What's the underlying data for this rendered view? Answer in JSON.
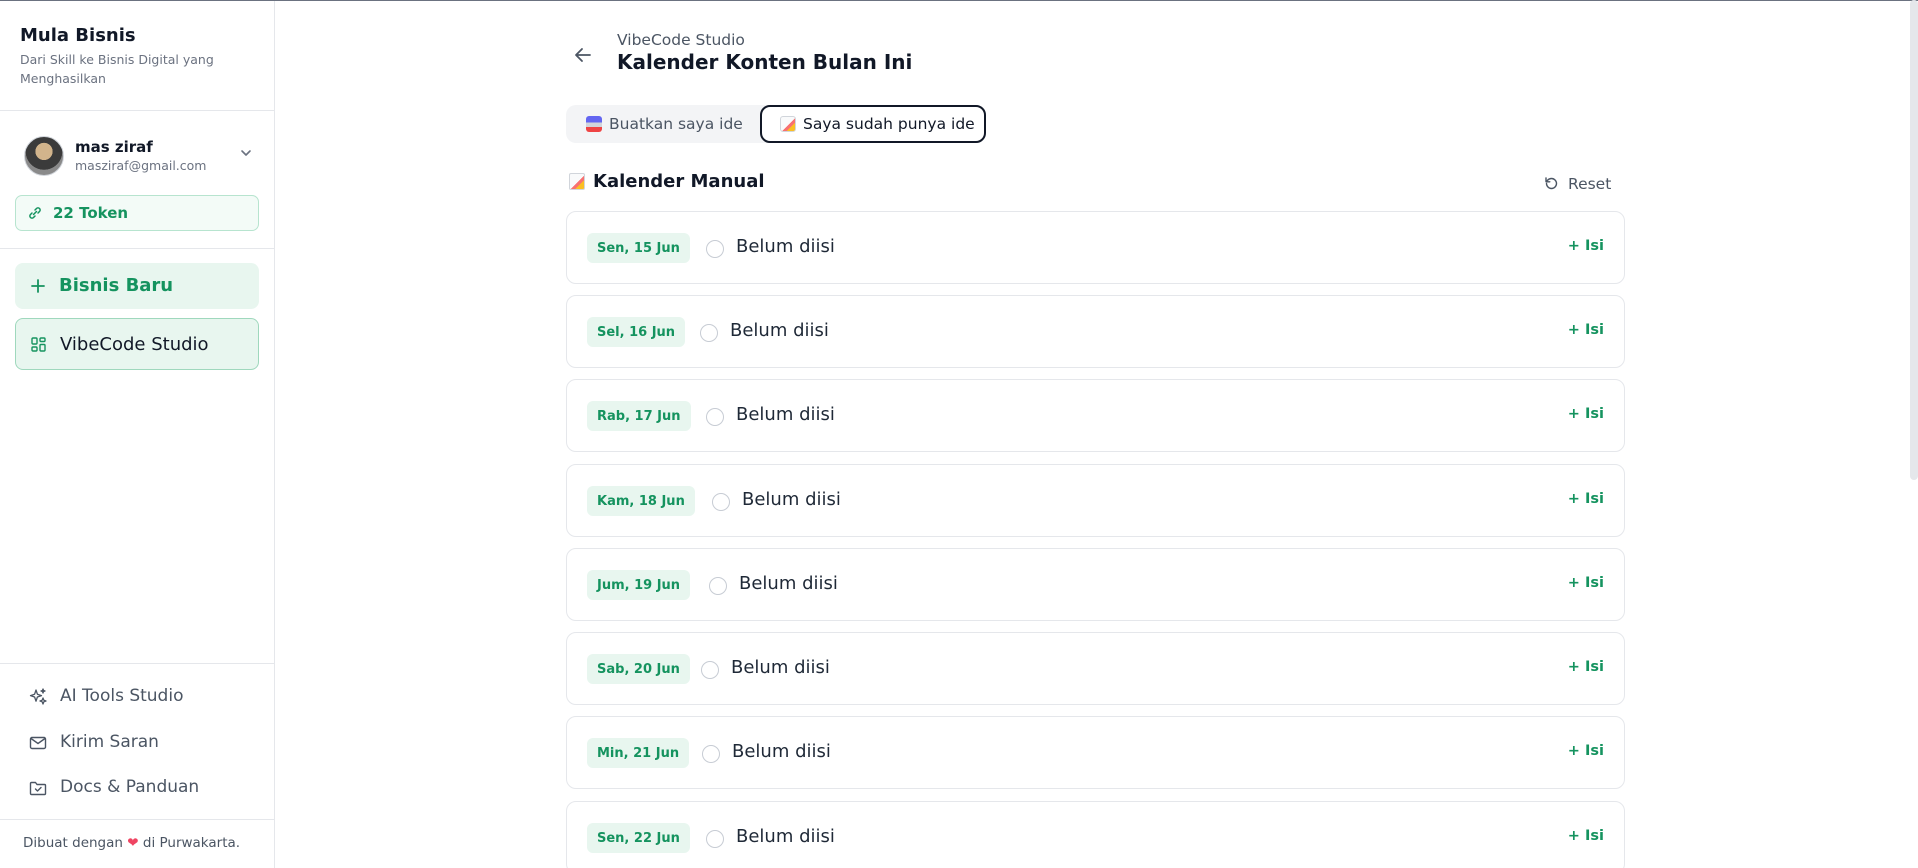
{
  "sidebar": {
    "brand_title": "Mula Bisnis",
    "brand_subtitle": "Dari Skill ke Bisnis Digital yang Menghasilkan",
    "user_name": "mas ziraf",
    "user_email": "masziraf@gmail.com",
    "token_label": "22 Token",
    "new_business_label": "Bisnis Baru",
    "studio_label": "VibeCode Studio",
    "ai_tools_label": "AI Tools Studio",
    "feedback_label": "Kirim Saran",
    "docs_label": "Docs & Panduan",
    "made_with_prefix": "Dibuat dengan",
    "made_with_suffix": "di Purwakarta."
  },
  "header": {
    "breadcrumb": "VibeCode Studio",
    "title": "Kalender Konten Bulan Ini"
  },
  "tabs": {
    "generate_label": "Buatkan saya ide",
    "manual_label": "Saya sudah punya ide",
    "active": "manual"
  },
  "section": {
    "title": "Kalender Manual",
    "reset_label": "Reset"
  },
  "calendar": {
    "add_label": "+ Isi",
    "rows": [
      {
        "date": "Sen, 15 Jun",
        "status": "Belum diisi"
      },
      {
        "date": "Sel, 16 Jun",
        "status": "Belum diisi"
      },
      {
        "date": "Rab, 17 Jun",
        "status": "Belum diisi"
      },
      {
        "date": "Kam, 18 Jun",
        "status": "Belum diisi"
      },
      {
        "date": "Jum, 19 Jun",
        "status": "Belum diisi"
      },
      {
        "date": "Sab, 20 Jun",
        "status": "Belum diisi"
      },
      {
        "date": "Min, 21 Jun",
        "status": "Belum diisi"
      },
      {
        "date": "Sen, 22 Jun",
        "status": "Belum diisi"
      }
    ]
  },
  "colors": {
    "accent": "#15935f",
    "accent_bg": "#e8f6ef",
    "heart": "#ef4462"
  }
}
